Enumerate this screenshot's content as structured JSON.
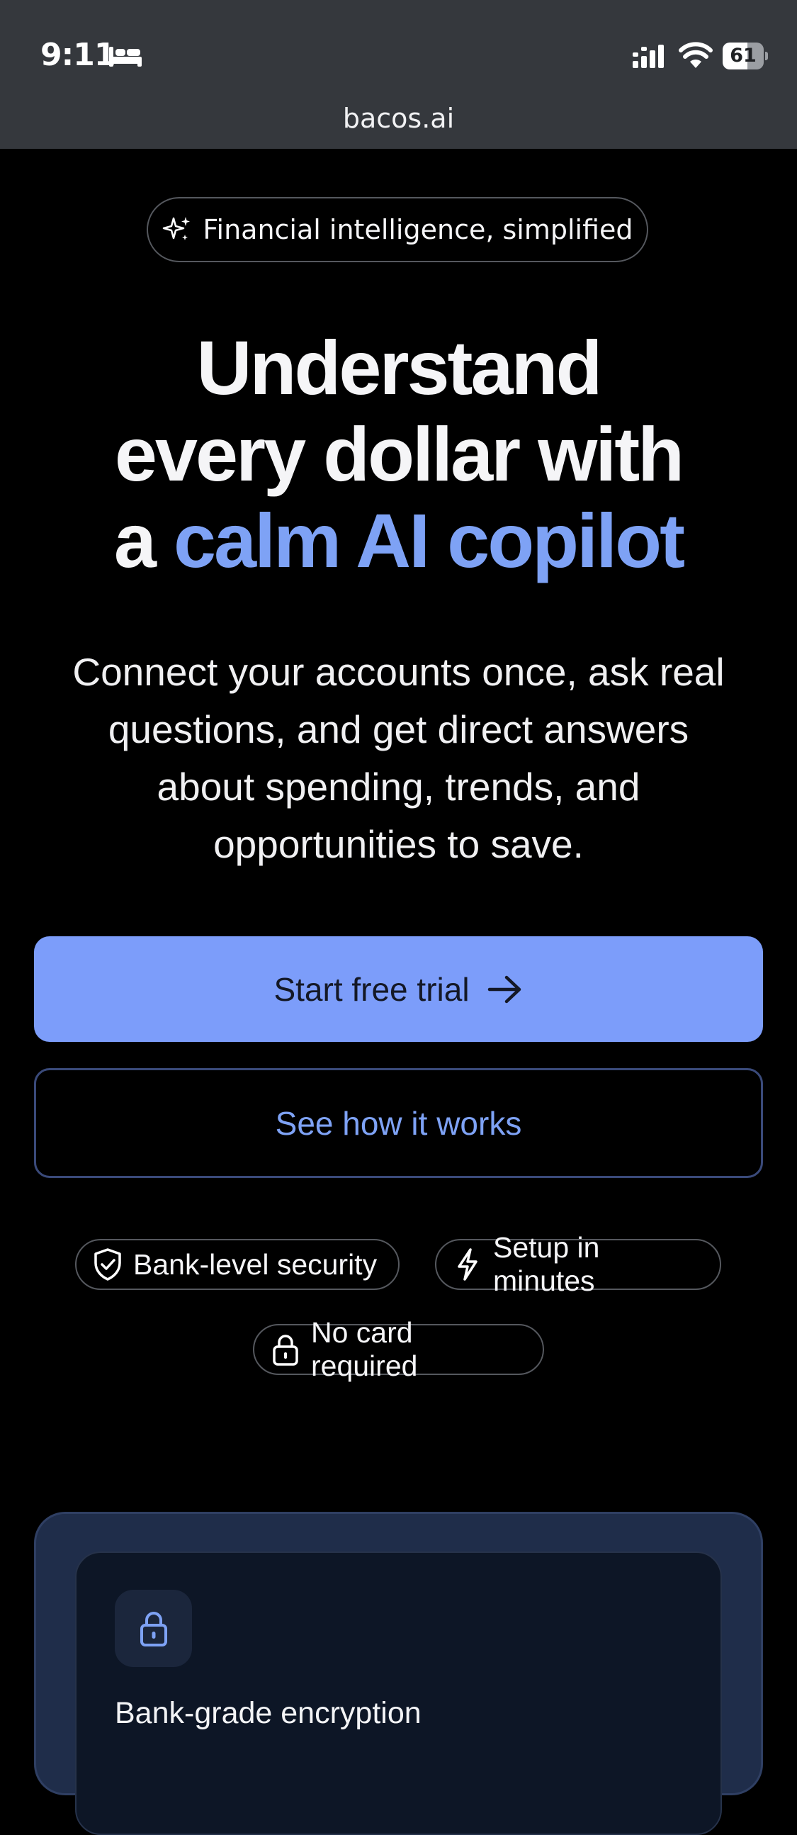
{
  "status_bar": {
    "time": "9:11",
    "battery_level": 61,
    "battery_text": "61"
  },
  "browser": {
    "url": "bacos.ai"
  },
  "hero": {
    "badge": "Financial intelligence, simplified",
    "headline_line1": "Understand",
    "headline_line2": "every dollar with",
    "headline_line3_prefix": "a ",
    "headline_accent": "calm AI copilot",
    "subheadline": "Connect your accounts once, ask real questions, and get direct answers about spending, trends, and opportunities to save.",
    "primary_cta": "Start free trial",
    "secondary_cta": "See how it works",
    "trust_badges": [
      "Bank-level security",
      "Setup in minutes",
      "No card required"
    ]
  },
  "feature_card": {
    "title": "Bank-grade encryption"
  },
  "colors": {
    "accent": "#7ea2f5",
    "primary_button": "#7c9dfa",
    "background": "#000000",
    "status_bar": "#35383d",
    "card_outer": "#1f2d4a",
    "card_inner": "#0d1626"
  },
  "icons": [
    "bed-icon",
    "signal-icon",
    "wifi-icon",
    "battery-icon",
    "sparkle-icon",
    "arrow-right-icon",
    "shield-check-icon",
    "lightning-icon",
    "lock-icon"
  ]
}
